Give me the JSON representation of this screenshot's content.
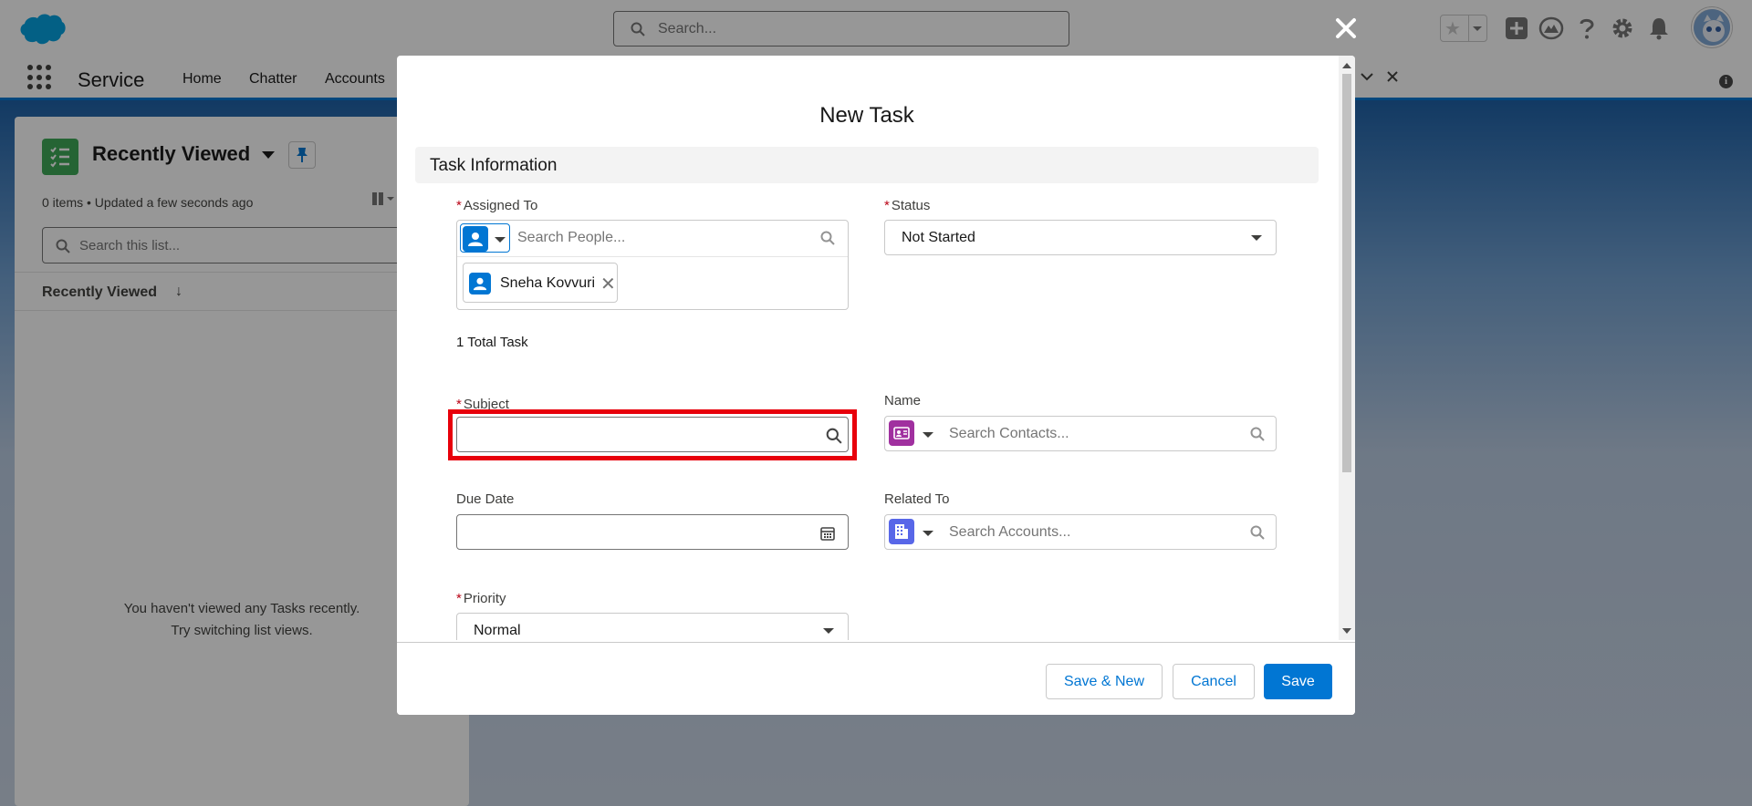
{
  "header": {
    "search_placeholder": "Search..."
  },
  "nav": {
    "app_name": "Service",
    "items": [
      {
        "label": "Home"
      },
      {
        "label": "Chatter"
      },
      {
        "label": "Accounts"
      }
    ]
  },
  "list_view": {
    "title": "Recently Viewed",
    "meta": "0 items • Updated a few seconds ago",
    "search_placeholder": "Search this list...",
    "column_header": "Recently Viewed",
    "empty_line1": "You haven't viewed any Tasks recently.",
    "empty_line2": "Try switching list views."
  },
  "modal": {
    "title": "New Task",
    "section": "Task Information",
    "assigned_to": {
      "label": "Assigned To",
      "placeholder": "Search People...",
      "pill": "Sneha Kovvuri"
    },
    "status": {
      "label": "Status",
      "value": "Not Started"
    },
    "total_tasks": "1 Total Task",
    "subject": {
      "label": "Subject",
      "value": ""
    },
    "name": {
      "label": "Name",
      "placeholder": "Search Contacts..."
    },
    "due_date": {
      "label": "Due Date",
      "value": ""
    },
    "related_to": {
      "label": "Related To",
      "placeholder": "Search Accounts..."
    },
    "priority": {
      "label": "Priority",
      "value": "Normal"
    },
    "required_marker": "*",
    "buttons": {
      "save_new": "Save & New",
      "cancel": "Cancel",
      "save": "Save"
    }
  },
  "colors": {
    "brand": "#0176d3",
    "required": "#ba0517",
    "highlight": "#e8000b",
    "people_icon": "#0176d3",
    "contact_icon": "#a0309f",
    "account_icon": "#5867e8",
    "task_list_icon": "#3ba755"
  }
}
